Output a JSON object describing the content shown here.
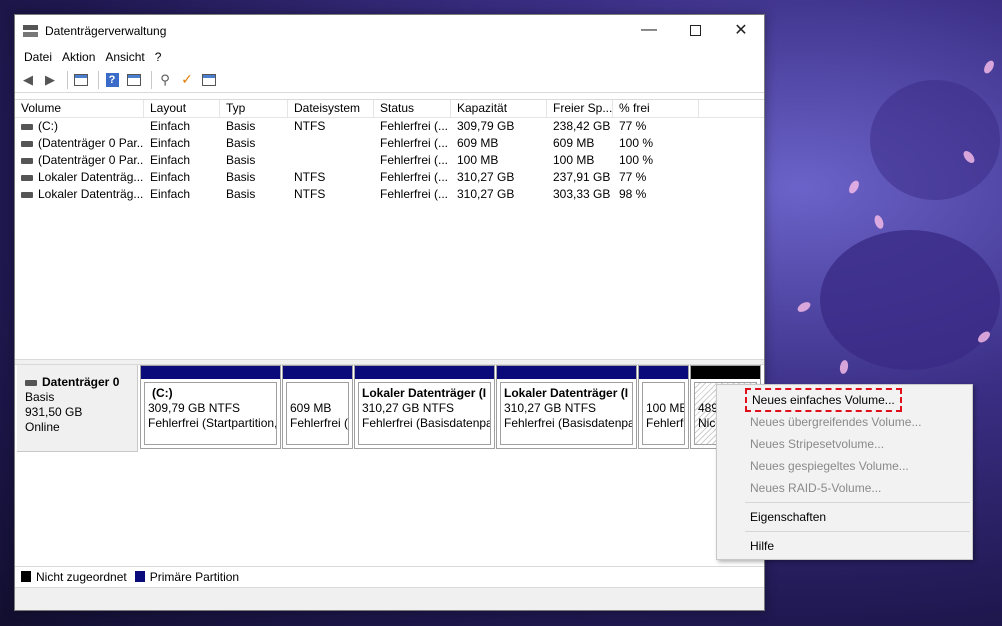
{
  "window": {
    "title": "Datenträgerverwaltung"
  },
  "menu": [
    "Datei",
    "Aktion",
    "Ansicht",
    "?"
  ],
  "list": {
    "headers": [
      "Volume",
      "Layout",
      "Typ",
      "Dateisystem",
      "Status",
      "Kapazität",
      "Freier Sp...",
      "% frei"
    ],
    "rows": [
      [
        "(C:)",
        "Einfach",
        "Basis",
        "NTFS",
        "Fehlerfrei (...",
        "309,79 GB",
        "238,42 GB",
        "77 %"
      ],
      [
        "(Datenträger 0 Par...",
        "Einfach",
        "Basis",
        "",
        "Fehlerfrei (...",
        "609 MB",
        "609 MB",
        "100 %"
      ],
      [
        "(Datenträger 0 Par...",
        "Einfach",
        "Basis",
        "",
        "Fehlerfrei (...",
        "100 MB",
        "100 MB",
        "100 %"
      ],
      [
        "Lokaler Datenträg...",
        "Einfach",
        "Basis",
        "NTFS",
        "Fehlerfrei (...",
        "310,27 GB",
        "237,91 GB",
        "77 %"
      ],
      [
        "Lokaler Datenträg...",
        "Einfach",
        "Basis",
        "NTFS",
        "Fehlerfrei (...",
        "310,27 GB",
        "303,33 GB",
        "98 %"
      ]
    ]
  },
  "disk": {
    "name": "Datenträger 0",
    "type": "Basis",
    "size": "931,50 GB",
    "state": "Online",
    "partitions": [
      {
        "title": "(C:)",
        "size": "309,79 GB NTFS",
        "status": "Fehlerfrei (Startpartition,"
      },
      {
        "title": "",
        "size": "609 MB",
        "status": "Fehlerfrei ("
      },
      {
        "title": "Lokaler Datenträger (I",
        "size": "310,27 GB NTFS",
        "status": "Fehlerfrei (Basisdatenpa"
      },
      {
        "title": "Lokaler Datenträger (I",
        "size": "310,27 GB NTFS",
        "status": "Fehlerfrei (Basisdatenpa"
      },
      {
        "title": "",
        "size": "100 MB",
        "status": "Fehlerf"
      },
      {
        "title": "",
        "size": "489",
        "status": "Nic"
      }
    ]
  },
  "legend": {
    "unallocated": "Nicht zugeordnet",
    "primary": "Primäre Partition"
  },
  "context_menu": {
    "items": [
      {
        "label": "Neues einfaches Volume...",
        "enabled": true,
        "highlighted": true
      },
      {
        "label": "Neues übergreifendes Volume...",
        "enabled": false
      },
      {
        "label": "Neues Stripesetvolume...",
        "enabled": false
      },
      {
        "label": "Neues gespiegeltes Volume...",
        "enabled": false
      },
      {
        "label": "Neues RAID-5-Volume...",
        "enabled": false
      },
      {
        "label": "Eigenschaften",
        "enabled": true
      },
      {
        "label": "Hilfe",
        "enabled": true
      }
    ]
  },
  "colors": {
    "primary_partition": "#0a0a7a",
    "unallocated": "#000000",
    "highlight_outline": "#e0101a"
  }
}
